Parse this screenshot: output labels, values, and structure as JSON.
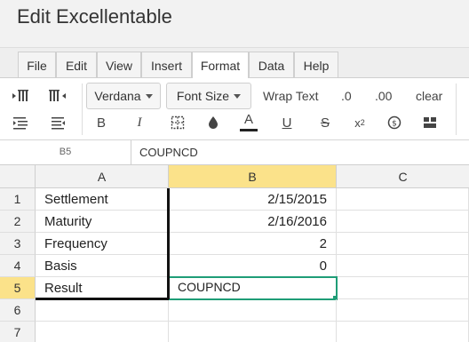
{
  "window": {
    "title": "Edit Excellentable"
  },
  "menu": {
    "tabs": [
      "File",
      "Edit",
      "View",
      "Insert",
      "Format",
      "Data",
      "Help"
    ],
    "active": "Format"
  },
  "toolbar": {
    "font_family": "Verdana",
    "font_size": "Font Size",
    "wrap_text": "Wrap Text",
    "decrease_decimal": ".0",
    "increase_decimal": ".00",
    "clear": "clear",
    "bold": "B",
    "italic": "I",
    "text_color": "A",
    "underline": "U",
    "strikethrough": "S",
    "superscript": "x",
    "superscript_exp": "2",
    "text_color_accent": "#222222"
  },
  "formula_bar": {
    "cell_ref": "B5",
    "value": "COUPNCD"
  },
  "grid": {
    "columns": [
      "A",
      "B",
      "C"
    ],
    "selected_column": "B",
    "rows": [
      {
        "num": "1",
        "a": "Settlement",
        "b": "2/15/2015"
      },
      {
        "num": "2",
        "a": "Maturity",
        "b": "2/16/2016"
      },
      {
        "num": "3",
        "a": "Frequency",
        "b": "2"
      },
      {
        "num": "4",
        "a": "Basis",
        "b": "0"
      },
      {
        "num": "5",
        "a": "Result",
        "b": "COUPNCD"
      },
      {
        "num": "6",
        "a": "",
        "b": ""
      },
      {
        "num": "7",
        "a": "",
        "b": ""
      }
    ],
    "selected_row": "5",
    "accent": "#1f9d77",
    "header_highlight": "#fbe28a"
  }
}
